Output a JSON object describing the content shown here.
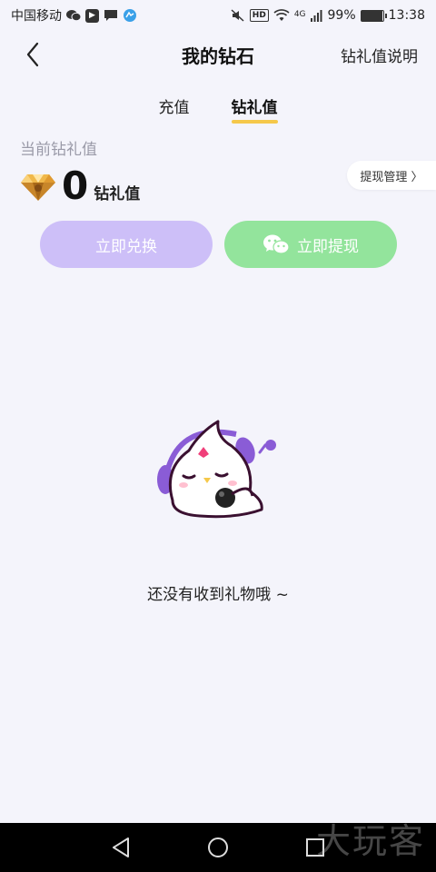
{
  "status_bar": {
    "carrier": "中国移动",
    "network": "4G",
    "battery": "99%",
    "battery_level": 0.99,
    "time": "13:38",
    "hd_label": "HD"
  },
  "nav": {
    "title": "我的钻石",
    "right_link": "钻礼值说明"
  },
  "tabs": [
    {
      "label": "充值",
      "active": false
    },
    {
      "label": "钻礼值",
      "active": true
    }
  ],
  "balance": {
    "label": "当前钻礼值",
    "value": "0",
    "unit": "钻礼值",
    "manage_link": "提现管理 〉"
  },
  "actions": {
    "exchange_label": "立即兑换",
    "withdraw_label": "立即提现"
  },
  "empty_state": {
    "text": "还没有收到礼物哦 ~"
  },
  "watermark": "大玩客",
  "colors": {
    "background": "#f4f4fb",
    "tab_indicator": "#f5c84a",
    "exchange_button": "#cdbff8",
    "withdraw_button": "#93e49c"
  }
}
